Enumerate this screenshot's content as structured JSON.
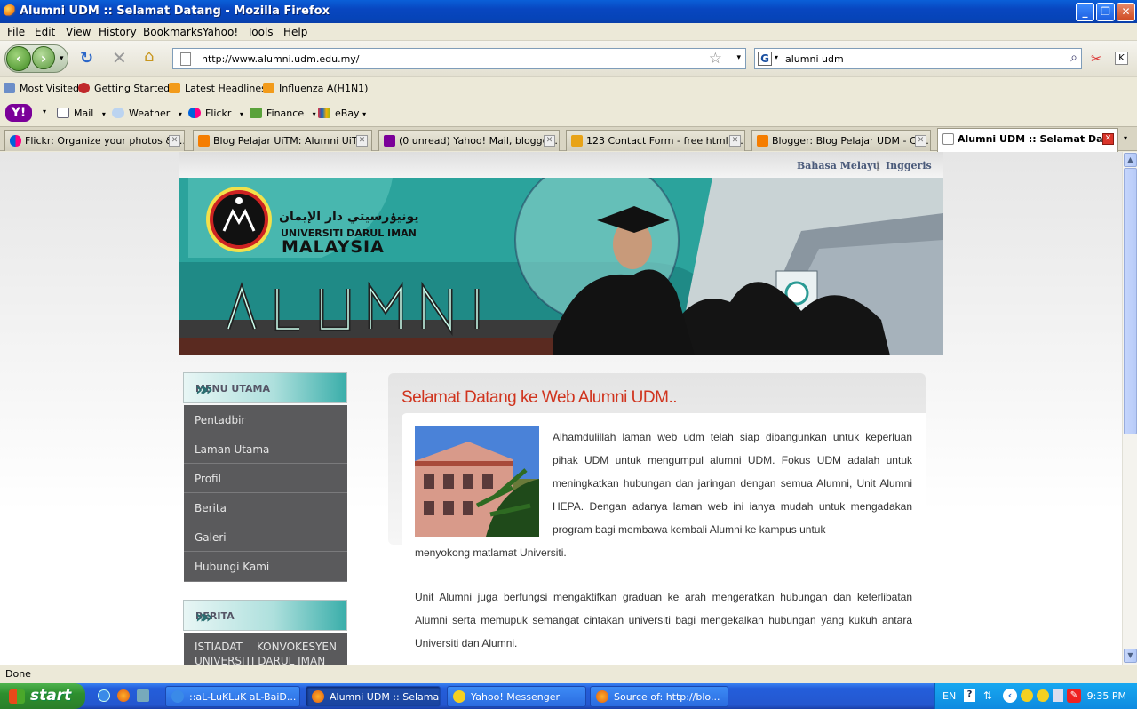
{
  "window": {
    "title": "Alumni UDM :: Selamat Datang - Mozilla Firefox"
  },
  "menubar": [
    "File",
    "Edit",
    "View",
    "History",
    "Bookmarks",
    "Yahoo!",
    "Tools",
    "Help"
  ],
  "navbar": {
    "url": "http://www.alumni.udm.edu.my/",
    "search_query": "alumni udm"
  },
  "bookmarks": [
    "Most Visited",
    "Getting Started",
    "Latest Headlines",
    "Influenza A(H1N1)"
  ],
  "yahoo_toolbar": {
    "mail": "Mail",
    "weather": "Weather",
    "flickr": "Flickr",
    "finance": "Finance",
    "ebay": "eBay"
  },
  "tabs": [
    {
      "label": "Flickr: Organize your photos & ...",
      "icon_color": "#ff0084"
    },
    {
      "label": "Blog Pelajar UiTM: Alumni UiTM",
      "icon_color": "#f57d00"
    },
    {
      "label": "(0 unread) Yahoo! Mail, blogge...",
      "icon_color": "#7b0099"
    },
    {
      "label": "123 Contact Form - free html f...",
      "icon_color": "#e8a317"
    },
    {
      "label": "Blogger: Blog Pelajar UDM - Cr...",
      "icon_color": "#f57d00"
    },
    {
      "label": "Alumni UDM :: Selamat Da...",
      "icon_color": "#ffffff"
    }
  ],
  "page": {
    "languages": [
      "Bahasa Melayu",
      "|",
      "Inggeris"
    ],
    "banner": {
      "arabic": "يونيۏرسيتي دار الإيمان",
      "university": "UNIVERSITI DARUL IMAN",
      "country": "MALAYSIA",
      "word": "ALUMNI"
    },
    "menu_utama_title": "MENU UTAMA",
    "menu_items": [
      "Pentadbir",
      "Laman Utama",
      "Profil",
      "Berita",
      "Galeri",
      "Hubungi Kami"
    ],
    "berita_title": "BERITA",
    "berita_item": "ISTIADAT KONVOKESYEN UNIVERSITI DARUL IMAN",
    "heading": "Selamat Datang ke Web Alumni UDM..",
    "para1a": "Alhamdulillah laman web udm telah siap dibangunkan untuk keperluan pihak UDM untuk mengumpul alumni UDM. Fokus UDM adalah untuk meningkatkan hubungan dan jaringan dengan semua Alumni, Unit Alumni HEPA. Dengan adanya laman web ini ianya mudah untuk mengadakan program bagi membawa kembali Alumni ke kampus untuk",
    "para1b": "menyokong matlamat Universiti.",
    "para2": "Unit Alumni juga berfungsi mengaktifkan graduan ke arah mengeratkan hubungan dan keterlibatan Alumni serta memupuk semangat cintakan universiti bagi mengekalkan hubungan yang kukuh antara Universiti dan Alumni."
  },
  "status": "Done",
  "taskbar": {
    "start": "start",
    "tasks": [
      "::aL-LuKLuK aL-BaiD...",
      "Alumni UDM :: Selama...",
      "Yahoo! Messenger",
      "Source of: http://blo..."
    ],
    "lang": "EN",
    "clock": "9:35 PM"
  }
}
